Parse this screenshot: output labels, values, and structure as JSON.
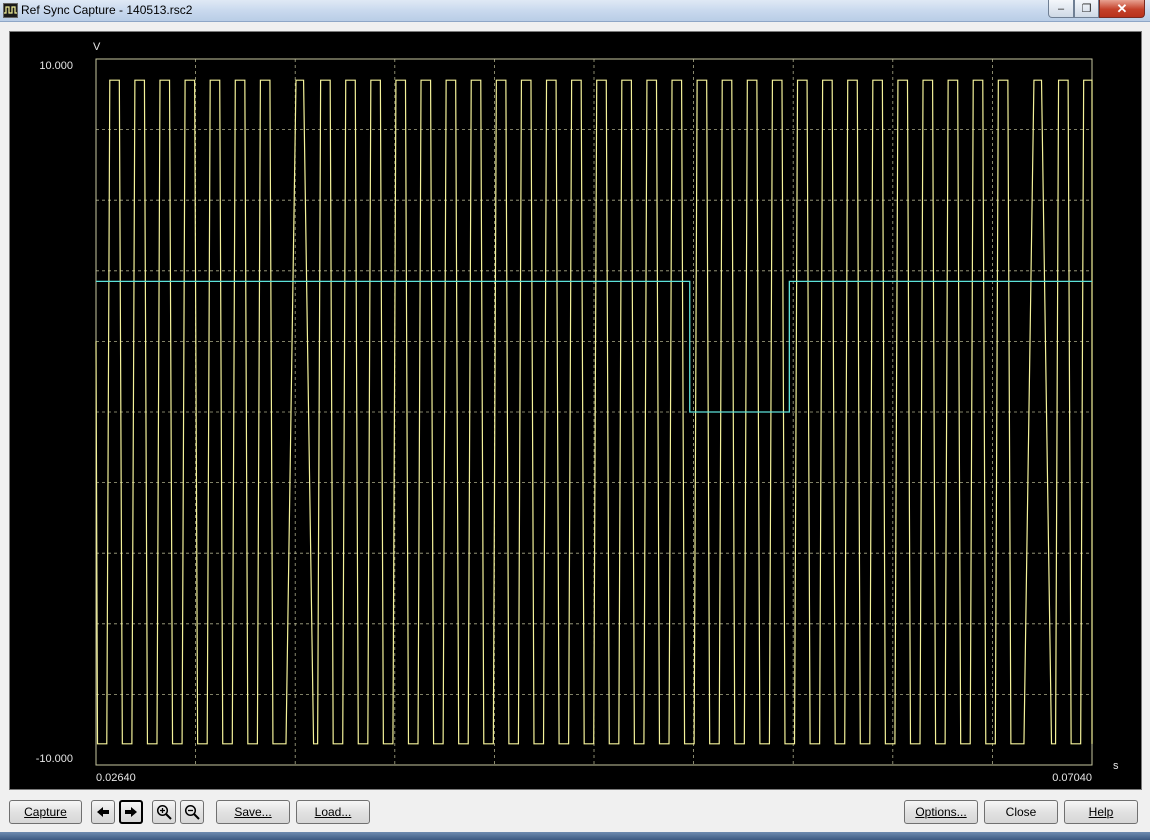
{
  "window": {
    "title": "Ref Sync Capture - 140513.rsc2",
    "controls": {
      "minimize": "‒",
      "maximize": "❐",
      "close": "✕"
    }
  },
  "plot": {
    "y_unit": "V",
    "x_unit": "s",
    "y_max_label": "10.000",
    "y_min_label": "-10.000",
    "x_min_label": "0.02640",
    "x_max_label": "0.07040",
    "background": "#000000",
    "grid_color": "#c8c8a0",
    "trace_colors": {
      "signal": "#f4f29a",
      "reference": "#5ce0d8"
    }
  },
  "chart_data": {
    "type": "line",
    "xlim": [
      0.0264,
      0.0704
    ],
    "ylim": [
      -10,
      10
    ],
    "grid": true,
    "series": [
      {
        "color": "#f4f29a",
        "description_of_values": "square wave switching between about +9.4 and -9.4",
        "high": 9.4,
        "low": -9.4
      },
      {
        "color": "#5ce0d8",
        "baseline": 3.7,
        "low": 0.0,
        "low_from": 0.05263,
        "low_to": 0.05703
      }
    ]
  },
  "toolbar": {
    "capture": "Capture",
    "save": "Save...",
    "load": "Load...",
    "options": "Options...",
    "close": "Close",
    "help": "Help",
    "icons": {
      "prev": "arrow-left-icon",
      "next": "arrow-right-icon",
      "zoom_in": "zoom-in-icon",
      "zoom_out": "zoom-out-icon"
    }
  }
}
